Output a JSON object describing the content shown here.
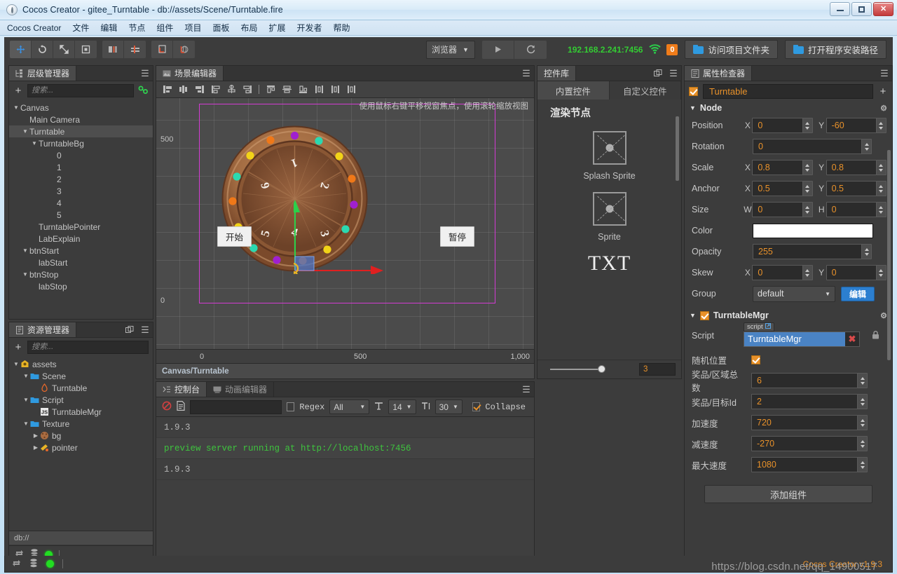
{
  "window": {
    "title": "Cocos Creator - gitee_Turntable - db://assets/Scene/Turntable.fire",
    "minimize": "—",
    "maximize": "❐",
    "close": "✕"
  },
  "menubar": [
    "Cocos Creator",
    "文件",
    "编辑",
    "节点",
    "组件",
    "项目",
    "面板",
    "布局",
    "扩展",
    "开发者",
    "帮助"
  ],
  "toolbar": {
    "transform_tools": [
      "move-tool",
      "rotate-tool",
      "scale-tool",
      "rect-tool"
    ],
    "pivot_tools": [
      "pivot-center",
      "pivot-pivot"
    ],
    "coord_tools": [
      "coord-local",
      "coord-global"
    ],
    "browser_select": "浏览器",
    "play_label": "play-icon",
    "refresh_label": "refresh-icon",
    "ip_address": "192.168.2.241:7456",
    "wifi_icon": "wifi-icon",
    "badge_count": "0",
    "open_project_folder": "访问项目文件夹",
    "open_install_path": "打开程序安装路径"
  },
  "hierarchy": {
    "tab": "层级管理器",
    "search_placeholder": "搜索...",
    "add_label": "+",
    "nodes": [
      {
        "label": "Canvas",
        "indent": 0,
        "arrow": "▼",
        "selected": false
      },
      {
        "label": "Main Camera",
        "indent": 1,
        "arrow": "",
        "selected": false
      },
      {
        "label": "Turntable",
        "indent": 1,
        "arrow": "▼",
        "selected": true
      },
      {
        "label": "TurntableBg",
        "indent": 2,
        "arrow": "▼",
        "selected": false
      },
      {
        "label": "0",
        "indent": 4,
        "arrow": "",
        "selected": false
      },
      {
        "label": "1",
        "indent": 4,
        "arrow": "",
        "selected": false
      },
      {
        "label": "2",
        "indent": 4,
        "arrow": "",
        "selected": false
      },
      {
        "label": "3",
        "indent": 4,
        "arrow": "",
        "selected": false
      },
      {
        "label": "4",
        "indent": 4,
        "arrow": "",
        "selected": false
      },
      {
        "label": "5",
        "indent": 4,
        "arrow": "",
        "selected": false
      },
      {
        "label": "TurntablePointer",
        "indent": 2,
        "arrow": "",
        "selected": false
      },
      {
        "label": "LabExplain",
        "indent": 2,
        "arrow": "",
        "selected": false
      },
      {
        "label": "btnStart",
        "indent": 1,
        "arrow": "▼",
        "selected": false
      },
      {
        "label": "labStart",
        "indent": 2,
        "arrow": "",
        "selected": false
      },
      {
        "label": "btnStop",
        "indent": 1,
        "arrow": "▼",
        "selected": false
      },
      {
        "label": "labStop",
        "indent": 2,
        "arrow": "",
        "selected": false
      }
    ]
  },
  "assets": {
    "tab": "资源管理器",
    "search_placeholder": "搜索...",
    "path_bar": "db://",
    "nodes": [
      {
        "label": "assets",
        "indent": 0,
        "arrow": "▼",
        "icon": "assets-icon"
      },
      {
        "label": "Scene",
        "indent": 1,
        "arrow": "▼",
        "icon": "folder-icon"
      },
      {
        "label": "Turntable",
        "indent": 2,
        "arrow": "",
        "icon": "fire-icon"
      },
      {
        "label": "Script",
        "indent": 1,
        "arrow": "▼",
        "icon": "folder-icon"
      },
      {
        "label": "TurntableMgr",
        "indent": 2,
        "arrow": "",
        "icon": "js-icon"
      },
      {
        "label": "Texture",
        "indent": 1,
        "arrow": "▼",
        "icon": "folder-icon"
      },
      {
        "label": "bg",
        "indent": 2,
        "arrow": "▶",
        "icon": "wheel-icon"
      },
      {
        "label": "pointer",
        "indent": 2,
        "arrow": "▶",
        "icon": "pointer-icon"
      }
    ]
  },
  "scene": {
    "tab": "场景编辑器",
    "hint": "使用鼠标右键平移视窗焦点，使用滚轮缩放视图",
    "status": "Canvas/Turntable",
    "ruler_left": [
      "500",
      "0"
    ],
    "ruler_bottom": [
      "0",
      "500",
      "1,000"
    ],
    "buttons": {
      "start": "开始",
      "stop": "暂停"
    },
    "wheel": {
      "segments": [
        "1",
        "2",
        "3",
        "4",
        "5",
        "6"
      ],
      "rim_dot_colors": [
        "#a020d0",
        "#2bd9b0",
        "#f2d318",
        "#f07818",
        "#a020d0",
        "#2bd9b0",
        "#f2d318",
        "#f07818",
        "#a020d0",
        "#2bd9b0",
        "#f2d318",
        "#f07818",
        "#a020d0",
        "#2bd9b0",
        "#f2d318",
        "#f07818"
      ],
      "wood_light": "#b0764a",
      "wood_dark": "#7a4a2c"
    }
  },
  "control_library": {
    "tab": "控件库",
    "subtabs": [
      "内置控件",
      "自定义控件"
    ],
    "section_title": "渲染节点",
    "items": [
      {
        "label": "Splash Sprite",
        "icon": "sprite-placeholder-icon"
      },
      {
        "label": "Sprite",
        "icon": "sprite-placeholder-icon"
      }
    ],
    "txt_glyph": "TXT",
    "zoom_value": "3"
  },
  "console": {
    "tabs": [
      "控制台",
      "动画编辑器"
    ],
    "active_tab": "控制台",
    "clear_icon": "clear-icon",
    "file_icon": "file-icon",
    "filter_value": "",
    "regex_label": "Regex",
    "regex_checked": false,
    "level_filter": "All",
    "font_icon_a": "text-size-icon",
    "font_size": "14",
    "font_icon_b": "line-height-icon",
    "line_height": "30",
    "collapse_label": "Collapse",
    "collapse_checked": true,
    "lines": [
      {
        "text": "1.9.3",
        "color": "normal"
      },
      {
        "text": "preview server running at http://localhost:7456",
        "color": "green"
      },
      {
        "text": "1.9.3",
        "color": "normal"
      }
    ]
  },
  "inspector": {
    "tab": "属性检查器",
    "node_enabled": true,
    "node_name": "Turntable",
    "add_icon": "+",
    "node_section": {
      "title": "Node",
      "gear_icon": "gear-icon",
      "rows": [
        {
          "label": "Position",
          "type": "xy",
          "x_axis": "X",
          "x": "0",
          "y_axis": "Y",
          "y": "-60"
        },
        {
          "label": "Rotation",
          "type": "single",
          "value": "0"
        },
        {
          "label": "Scale",
          "type": "xy",
          "x_axis": "X",
          "x": "0.8",
          "y_axis": "Y",
          "y": "0.8"
        },
        {
          "label": "Anchor",
          "type": "xy",
          "x_axis": "X",
          "x": "0.5",
          "y_axis": "Y",
          "y": "0.5"
        },
        {
          "label": "Size",
          "type": "xy",
          "x_axis": "W",
          "x": "0",
          "y_axis": "H",
          "y": "0"
        },
        {
          "label": "Color",
          "type": "color",
          "value": "#ffffff"
        },
        {
          "label": "Opacity",
          "type": "single",
          "value": "255"
        },
        {
          "label": "Skew",
          "type": "xy",
          "x_axis": "X",
          "x": "0",
          "y_axis": "Y",
          "y": "0"
        },
        {
          "label": "Group",
          "type": "group",
          "value": "default",
          "button": "编辑"
        }
      ]
    },
    "component": {
      "enabled": true,
      "title": "TurntableMgr",
      "gear_icon": "gear-icon",
      "script_label": "Script",
      "script_tag": "script",
      "script_value": "TurntableMgr",
      "remove_icon": "✖",
      "props": [
        {
          "label": "随机位置",
          "type": "checkbox",
          "checked": true
        },
        {
          "label": "奖品/区域总数",
          "type": "number",
          "value": "6"
        },
        {
          "label": "奖品/目标Id",
          "type": "number",
          "value": "2"
        },
        {
          "label": "加速度",
          "type": "number",
          "value": "720"
        },
        {
          "label": "减速度",
          "type": "number",
          "value": "-270"
        },
        {
          "label": "最大速度",
          "type": "number",
          "value": "1080"
        }
      ]
    },
    "add_component": "添加组件"
  },
  "statusbar": {
    "sync_icon": "sync-icon",
    "db_icon": "database-icon",
    "status_dot": "status-dot-green",
    "watermark": "https://blog.csdn.net/qq_14900517",
    "version": "Cocos Creator v1.9.3"
  }
}
